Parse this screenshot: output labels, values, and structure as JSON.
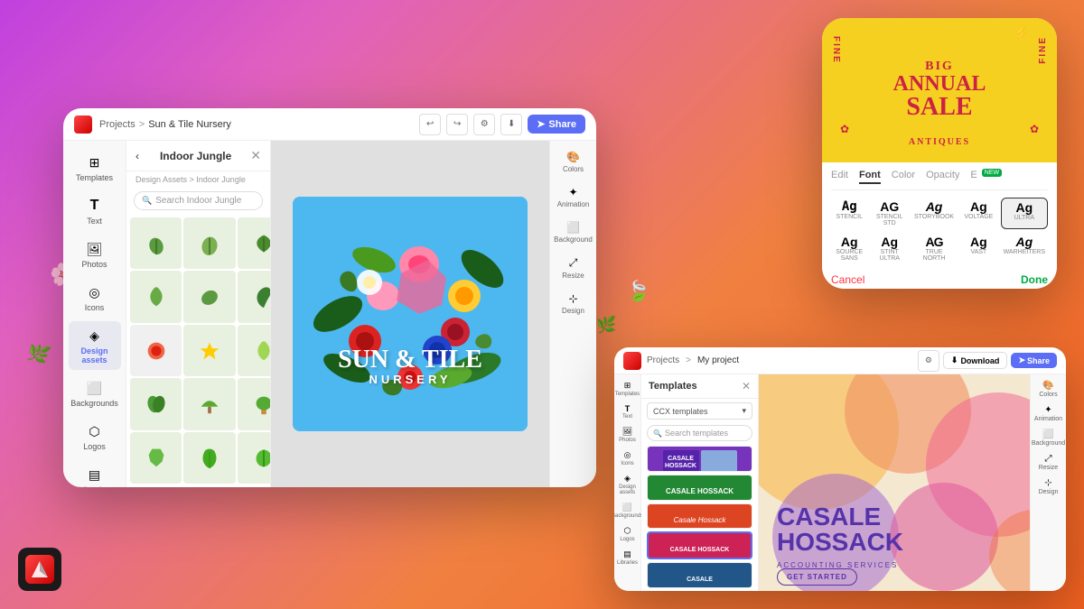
{
  "background": {
    "gradient": "linear-gradient(135deg, #c040e0 0%, #e060c0 20%, #f08040 60%, #f06020 100%)"
  },
  "adobe_logo": {
    "alt": "Adobe Express Logo"
  },
  "tablet_left": {
    "header": {
      "breadcrumb": {
        "projects": "Projects",
        "separator": ">",
        "current": "Sun & Tile Nursery"
      },
      "share_button": "Share"
    },
    "left_panel": {
      "items": [
        {
          "label": "Templates",
          "icon": "⊞"
        },
        {
          "label": "Text",
          "icon": "T"
        },
        {
          "label": "Photos",
          "icon": "🖼"
        },
        {
          "label": "Icons",
          "icon": "◎"
        },
        {
          "label": "Design assets",
          "icon": "◈"
        },
        {
          "label": "Backgrounds",
          "icon": "⬜"
        },
        {
          "label": "Logos",
          "icon": "⬡"
        },
        {
          "label": "Libraries",
          "icon": "▤"
        }
      ]
    },
    "assets_panel": {
      "title": "Indoor Jungle",
      "breadcrumb": "Design Assets > Indoor Jungle",
      "search_placeholder": "Search Indoor Jungle"
    },
    "canvas": {
      "main_text": "Sun & Tile",
      "subtitle": "Nursery",
      "background_color": "#4db8f0"
    },
    "right_bar": {
      "items": [
        {
          "label": "Colors",
          "icon": "🎨"
        },
        {
          "label": "Animation",
          "icon": "✦"
        },
        {
          "label": "Background",
          "icon": "⬜"
        },
        {
          "label": "Resize",
          "icon": "⤢"
        },
        {
          "label": "Design",
          "icon": "⊹"
        }
      ]
    }
  },
  "phone_mockup": {
    "canvas": {
      "main_text": "Big Annual Sale",
      "sub_text": "ANTIQUES",
      "fine_text": "FINE",
      "background_color": "#f5d020",
      "text_color": "#cc2244"
    },
    "tabs": [
      {
        "label": "Edit",
        "active": false
      },
      {
        "label": "Font",
        "active": true
      },
      {
        "label": "Color",
        "active": false
      },
      {
        "label": "Opacity",
        "active": false
      },
      {
        "label": "E",
        "active": false,
        "badge": "NEW"
      }
    ],
    "fonts": [
      {
        "char": "Ag",
        "name": "STENCIL",
        "style": "stencil"
      },
      {
        "char": "AG",
        "name": "STENCIL STD",
        "style": "bold"
      },
      {
        "char": "Ag",
        "name": "STORYBOOK",
        "style": "normal"
      },
      {
        "char": "Ag",
        "name": "VOLTAGE",
        "style": "italic"
      },
      {
        "char": "Ag",
        "name": "ULTRA",
        "style": "ultra",
        "selected": true
      },
      {
        "char": "Ag",
        "name": "SOURCE SANS",
        "style": "normal"
      },
      {
        "char": "Ag",
        "name": "STINT ULTRA",
        "style": "normal"
      },
      {
        "char": "AG",
        "name": "TRUE NORTH",
        "style": "bold"
      },
      {
        "char": "Ag",
        "name": "VAST",
        "style": "normal"
      },
      {
        "char": "Ag",
        "name": "WARHEITERS",
        "style": "italic"
      }
    ],
    "actions": {
      "cancel": "Cancel",
      "done": "Done"
    }
  },
  "tablet_right": {
    "header": {
      "breadcrumb": {
        "projects": "Projects",
        "separator": ">",
        "current": "My project"
      },
      "download_button": "Download",
      "share_button": "Share"
    },
    "templates_panel": {
      "title": "Templates",
      "dropdown": "CCX templates",
      "search_placeholder": "Search templates",
      "items": [
        {
          "text": "CASALE\nHOSSACK",
          "bg": "#8844cc",
          "img": true
        },
        {
          "text": "CASALE\nHOSSACK",
          "bg": "#228844"
        },
        {
          "text": "Casale\nHossack",
          "bg": "#ee4422"
        },
        {
          "text": "CASALE\nHOSSACK",
          "bg": "#cc3366"
        }
      ]
    },
    "canvas": {
      "title": "CASALE\nHOSSACK",
      "subtitle": "ACCOUNTING SERVICES",
      "cta": "GET STARTED",
      "background": "geometric"
    }
  }
}
